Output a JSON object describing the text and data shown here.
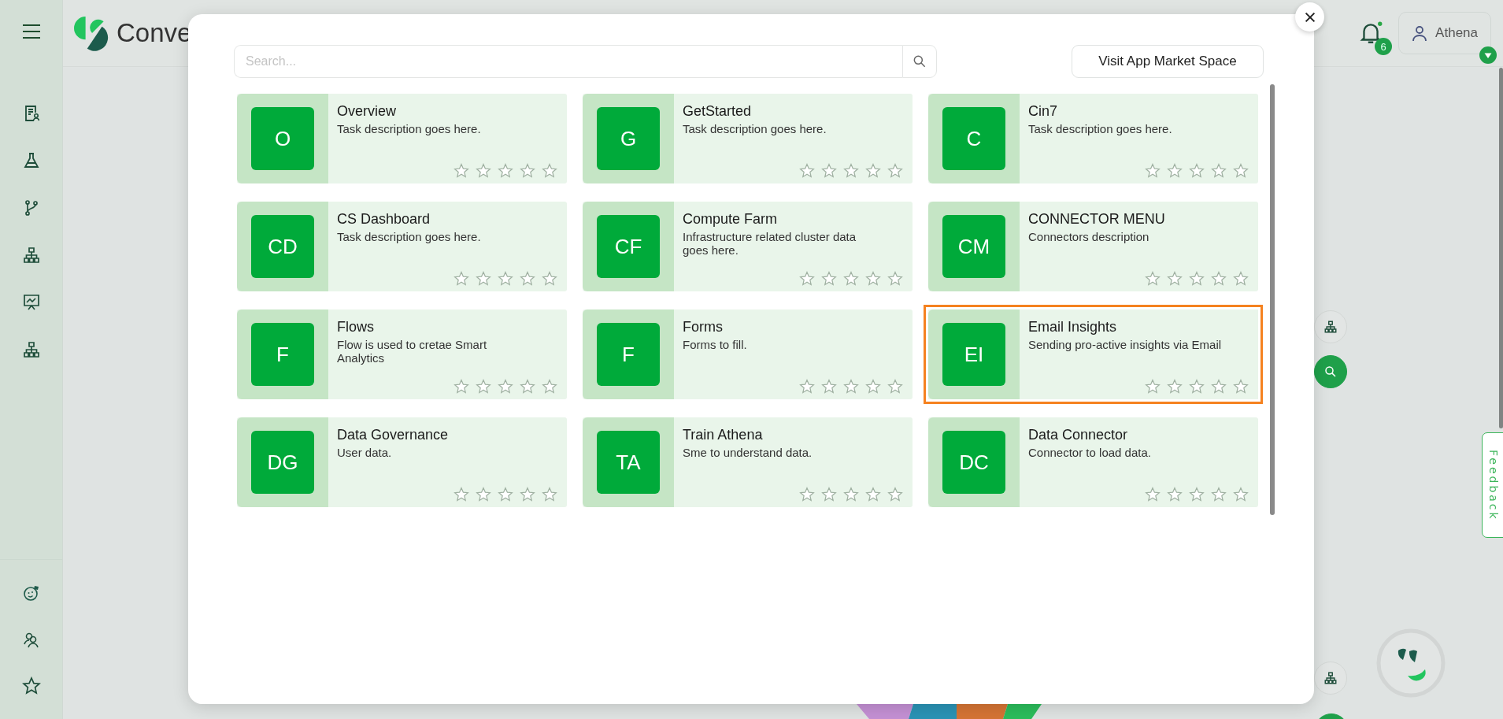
{
  "header": {
    "logo_text": "Conve",
    "notifications": {
      "count": "6"
    },
    "user": {
      "name": "Athena"
    }
  },
  "modal": {
    "search": {
      "placeholder": "Search..."
    },
    "market_button": "Visit App Market Space",
    "apps": [
      {
        "initials": "O",
        "title": "Overview",
        "description": "Task description goes here.",
        "stars": 0,
        "selected": false
      },
      {
        "initials": "G",
        "title": "GetStarted",
        "description": "Task description goes here.",
        "stars": 0,
        "selected": false
      },
      {
        "initials": "C",
        "title": "Cin7",
        "description": "Task description goes here.",
        "stars": 0,
        "selected": false
      },
      {
        "initials": "CD",
        "title": "CS Dashboard",
        "description": "Task description goes here.",
        "stars": 0,
        "selected": false
      },
      {
        "initials": "CF",
        "title": "Compute Farm",
        "description": "Infrastructure related cluster data goes here.",
        "stars": 0,
        "selected": false
      },
      {
        "initials": "CM",
        "title": "CONNECTOR MENU",
        "description": "Connectors description",
        "stars": 0,
        "selected": false
      },
      {
        "initials": "F",
        "title": "Flows",
        "description": "Flow is used to cretae Smart Analytics",
        "stars": 0,
        "selected": false
      },
      {
        "initials": "F",
        "title": "Forms",
        "description": "Forms to fill.",
        "stars": 0,
        "selected": false
      },
      {
        "initials": "EI",
        "title": "Email Insights",
        "description": "Sending pro-active insights via Email",
        "stars": 0,
        "selected": true
      },
      {
        "initials": "DG",
        "title": "Data Governance",
        "description": "User data.",
        "stars": 0,
        "selected": false
      },
      {
        "initials": "TA",
        "title": "Train Athena",
        "description": "Sme to understand data.",
        "stars": 0,
        "selected": false
      },
      {
        "initials": "DC",
        "title": "Data Connector",
        "description": "Connector to load data.",
        "stars": 0,
        "selected": false
      }
    ]
  },
  "feedback_tab": "Feedback"
}
